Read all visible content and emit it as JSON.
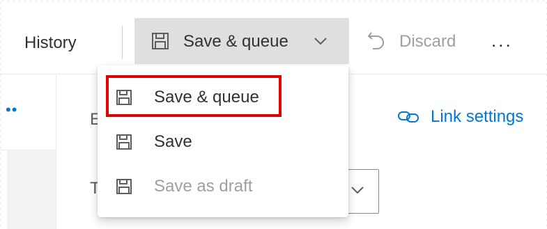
{
  "toolbar": {
    "history_label": "History",
    "save_queue_label": "Save & queue",
    "discard_label": "Discard",
    "more_label": "..."
  },
  "dropdown": {
    "items": [
      {
        "label": "Save & queue",
        "icon": "floppy-disk-icon",
        "enabled": true,
        "highlighted": true
      },
      {
        "label": "Save",
        "icon": "floppy-disk-icon",
        "enabled": true
      },
      {
        "label": "Save as draft",
        "icon": "floppy-disk-icon",
        "enabled": false
      }
    ]
  },
  "content": {
    "partial_label_1": "E",
    "partial_label_2": "T",
    "link_settings_label": "Link settings",
    "left_dots": "••"
  },
  "colors": {
    "accent": "#0078d4",
    "highlight": "#e00000",
    "selected_bg": "#e1dfdd",
    "disabled_text": "#a19f9d"
  }
}
